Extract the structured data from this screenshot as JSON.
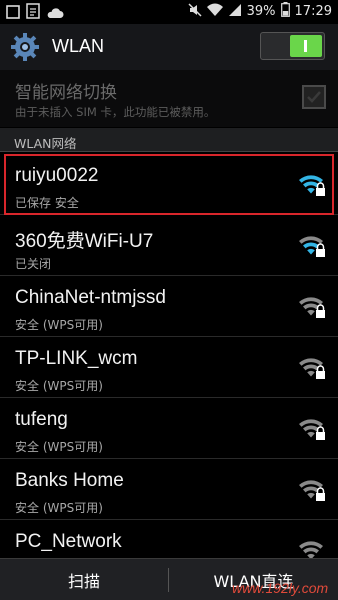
{
  "status_bar": {
    "battery": "39%",
    "time": "17:29",
    "icons": [
      "notification-square-icon",
      "doc-icon",
      "cloud-icon",
      "mute-icon",
      "wifi-signal-icon",
      "cell-signal-icon",
      "battery-icon"
    ]
  },
  "action_bar": {
    "title": "WLAN",
    "toggle_state": "on",
    "toggle_color": "#6ad64a"
  },
  "smart_switch": {
    "title": "智能网络切换",
    "subtitle": "由于未插入 SIM 卡，此功能已被禁用。",
    "checked": false
  },
  "section": {
    "label": "WLAN网络"
  },
  "networks": [
    {
      "name": "ruiyu0022",
      "status": "已保存 安全",
      "active": true
    },
    {
      "name": "360免费WiFi-U7",
      "status": "已关闭",
      "active": false
    },
    {
      "name": "ChinaNet-ntmjssd",
      "status": "安全 (WPS可用)",
      "active": false
    },
    {
      "name": "TP-LINK_wcm",
      "status": "安全 (WPS可用)",
      "active": false
    },
    {
      "name": "tufeng",
      "status": "安全 (WPS可用)",
      "active": false
    },
    {
      "name": "Banks Home",
      "status": "安全 (WPS可用)",
      "active": false
    },
    {
      "name": "PC_Network",
      "status": "",
      "active": false
    }
  ],
  "bottom_bar": {
    "scan_label": "扫描",
    "direct_label": "WLAN直连"
  },
  "watermark": "www.192ly.com",
  "colors": {
    "accent_blue": "#33b5e5",
    "highlight_red": "#d9262b",
    "signal_gray": "#8a8a8a"
  }
}
